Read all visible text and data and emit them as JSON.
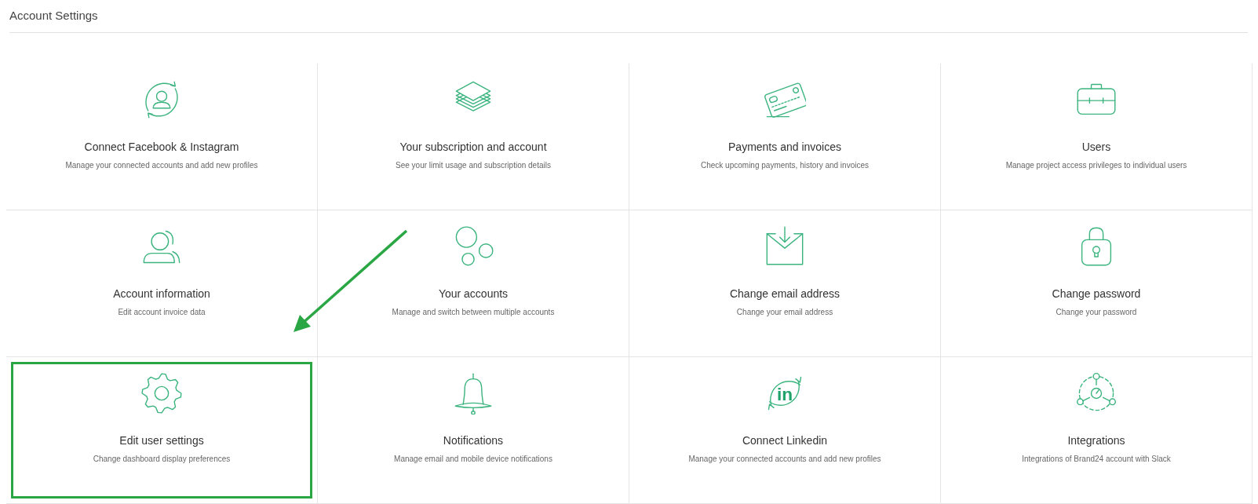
{
  "page": {
    "title": "Account Settings"
  },
  "cards": [
    {
      "kind": "sync-person",
      "title": "Connect Facebook & Instagram",
      "description": "Manage your connected accounts and add new profiles",
      "highlighted": false
    },
    {
      "kind": "layers",
      "title": "Your subscription and account",
      "description": "See your limit usage and subscription details",
      "highlighted": false
    },
    {
      "kind": "card",
      "title": "Payments and invoices",
      "description": "Check upcoming payments, history and invoices",
      "highlighted": false
    },
    {
      "kind": "briefcase",
      "title": "Users",
      "description": "Manage project access privileges to individual users",
      "highlighted": false
    },
    {
      "kind": "person",
      "title": "Account information",
      "description": "Edit account invoice data",
      "highlighted": false
    },
    {
      "kind": "bubbles",
      "title": "Your accounts",
      "description": "Manage and switch between multiple accounts",
      "highlighted": false
    },
    {
      "kind": "mail",
      "title": "Change email address",
      "description": "Change your email address",
      "highlighted": false
    },
    {
      "kind": "lock",
      "title": "Change password",
      "description": "Change your password",
      "highlighted": false
    },
    {
      "kind": "gear",
      "title": "Edit user settings",
      "description": "Change dashboard display preferences",
      "highlighted": true
    },
    {
      "kind": "bell",
      "title": "Notifications",
      "description": "Manage email and mobile device notifications",
      "highlighted": false
    },
    {
      "kind": "sync-text",
      "icon_text": "in",
      "title": "Connect Linkedin",
      "description": "Manage your connected accounts and add new profiles",
      "highlighted": false
    },
    {
      "kind": "network",
      "title": "Integrations",
      "description": "Integrations of Brand24 account with Slack",
      "highlighted": false
    }
  ],
  "annotation": {
    "kind": "arrow"
  }
}
